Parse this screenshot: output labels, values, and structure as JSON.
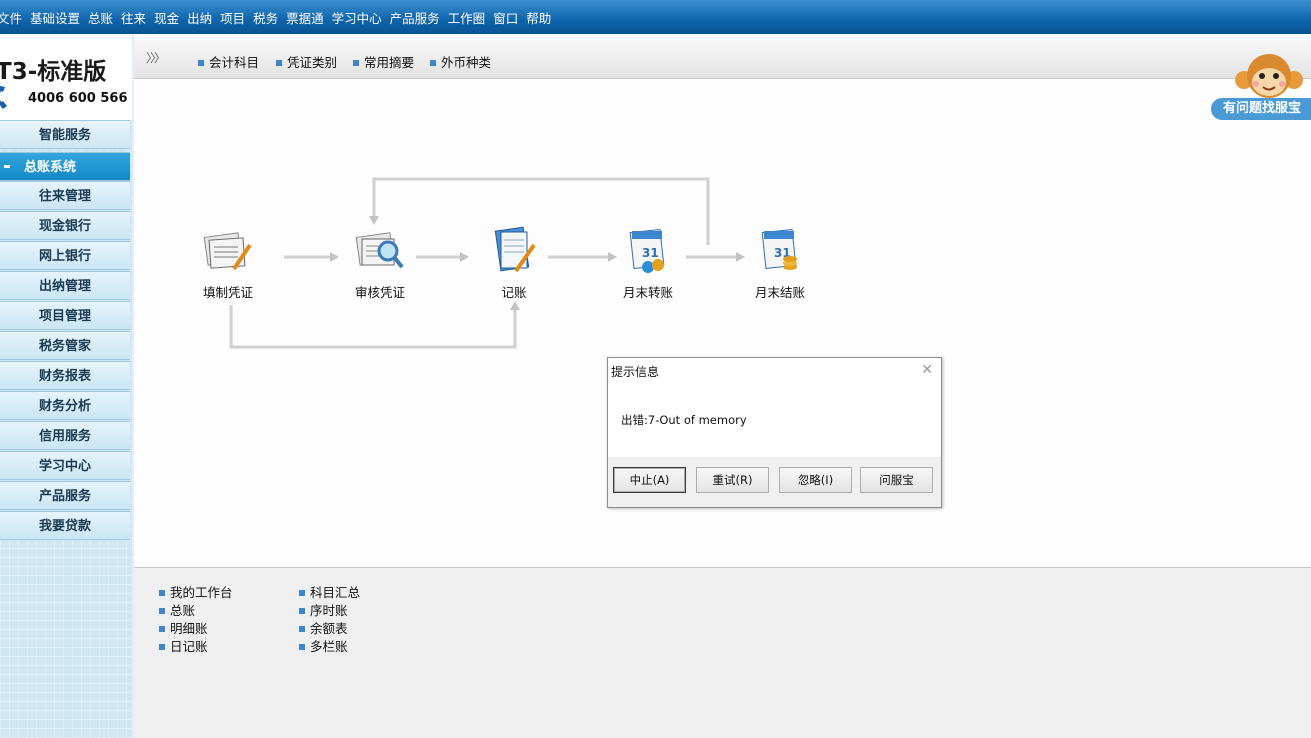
{
  "menu": [
    "文件",
    "基础设置",
    "总账",
    "往来",
    "现金",
    "出纳",
    "项目",
    "税务",
    "票据通",
    "学习中心",
    "产品服务",
    "工作圈",
    "窗口",
    "帮助"
  ],
  "logo": {
    "brand": "T3-标准版",
    "phone": "4006 600 566"
  },
  "sidebar": {
    "items": [
      {
        "label": "智能服务"
      },
      {
        "label": "总账系统"
      },
      {
        "label": "往来管理"
      },
      {
        "label": "现金银行"
      },
      {
        "label": "网上银行"
      },
      {
        "label": "出纳管理"
      },
      {
        "label": "项目管理"
      },
      {
        "label": "税务管家"
      },
      {
        "label": "财务报表"
      },
      {
        "label": "财务分析"
      },
      {
        "label": "信用服务"
      },
      {
        "label": "学习中心"
      },
      {
        "label": "产品服务"
      },
      {
        "label": "我要贷款"
      }
    ]
  },
  "toolbar": {
    "items": [
      "会计科目",
      "凭证类别",
      "常用摘要",
      "外币种类"
    ]
  },
  "assistant": {
    "label": "有问题找服宝"
  },
  "flow": {
    "nodes": [
      {
        "label": "填制凭证",
        "icon": "voucher-entry-icon"
      },
      {
        "label": "审核凭证",
        "icon": "voucher-audit-icon"
      },
      {
        "label": "记账",
        "icon": "posting-icon"
      },
      {
        "label": "月末转账",
        "icon": "month-end-transfer-icon"
      },
      {
        "label": "月末结账",
        "icon": "month-end-close-icon"
      }
    ]
  },
  "bottom_links": {
    "col1": [
      "我的工作台",
      "总账",
      "明细账",
      "日记账"
    ],
    "col2": [
      "科目汇总",
      "序时账",
      "余额表",
      "多栏账"
    ]
  },
  "dialog": {
    "title": "提示信息",
    "message": "出错:7-Out of memory",
    "buttons": [
      "中止(A)",
      "重试(R)",
      "忽略(I)",
      "问服宝"
    ]
  },
  "colors": {
    "menubar": "#0e63aa",
    "active_nav": "#1288c6",
    "accent": "#3c86c9"
  }
}
